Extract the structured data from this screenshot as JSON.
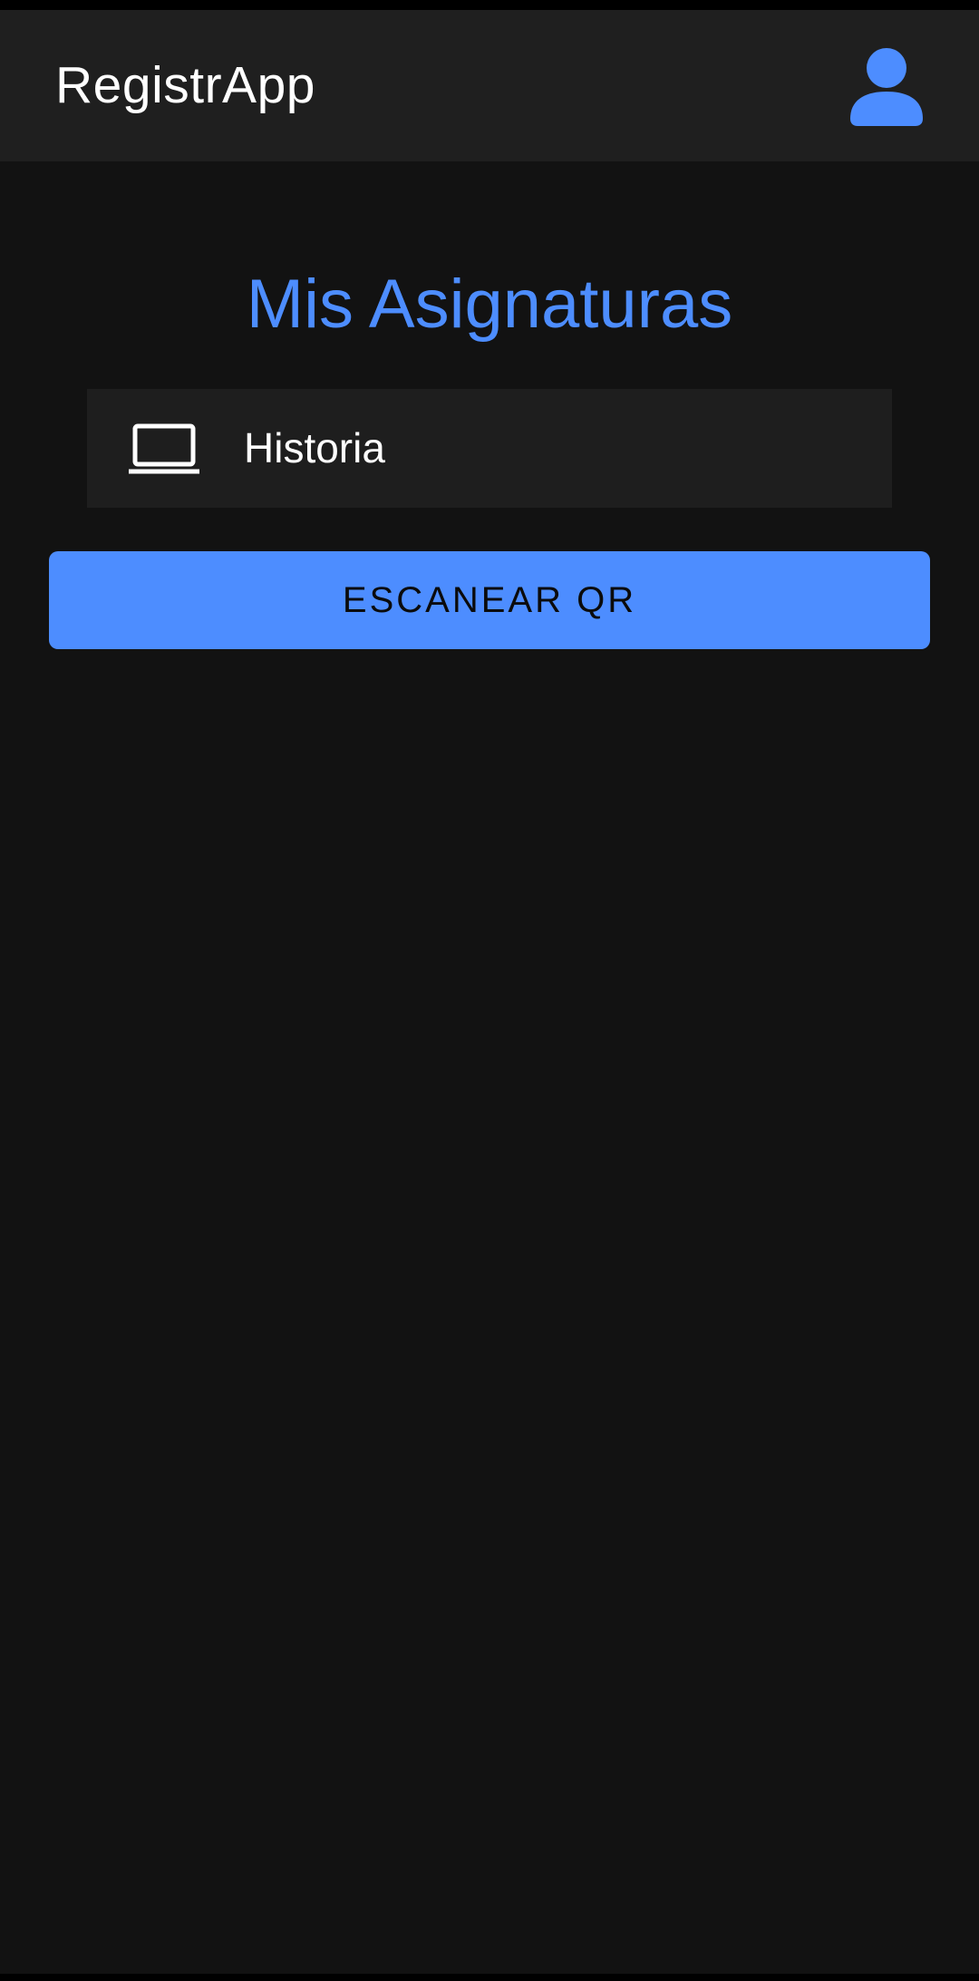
{
  "toolbar": {
    "title": "RegistrApp",
    "profile_icon": "person-icon"
  },
  "main": {
    "heading": "Mis Asignaturas",
    "subjects": [
      {
        "label": "Historia",
        "icon": "laptop-icon"
      }
    ],
    "scan_button_label": "ESCANEAR QR"
  },
  "colors": {
    "accent": "#4d8dff",
    "background": "#121212",
    "toolbar": "#1f1f1f",
    "item_background": "#1e1e1e",
    "text": "#ffffff"
  }
}
